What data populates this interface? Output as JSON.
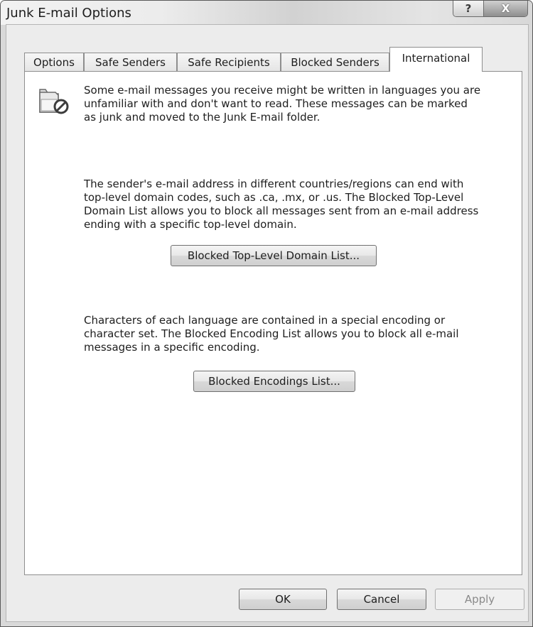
{
  "window": {
    "title": "Junk E-mail Options",
    "help_glyph": "?",
    "close_glyph": "X"
  },
  "tabs": [
    {
      "label": "Options",
      "active": false
    },
    {
      "label": "Safe Senders",
      "active": false
    },
    {
      "label": "Safe Recipients",
      "active": false
    },
    {
      "label": "Blocked Senders",
      "active": false
    },
    {
      "label": "International",
      "active": true
    }
  ],
  "panel": {
    "icon": "blocked-mailbox-icon",
    "intro": [
      "Some e-mail messages you receive might be written in languages you are",
      "unfamiliar with and don't want to read. These messages can be marked",
      "as junk and moved to the Junk E-mail folder."
    ],
    "tld_text": [
      "The sender's e-mail address in different countries/regions can end with",
      "top-level domain codes, such as .ca, .mx, or .us. The Blocked Top-Level",
      "Domain List allows you to block all messages sent from an e-mail address",
      "ending with a specific top-level domain."
    ],
    "tld_button": "Blocked Top-Level Domain List...",
    "encoding_text": [
      "Characters of each language are contained in a special encoding or",
      "character set. The Blocked Encoding List allows you to block all e-mail",
      "messages in a specific encoding."
    ],
    "encoding_button": "Blocked Encodings List..."
  },
  "footer": {
    "ok": "OK",
    "cancel": "Cancel",
    "apply": "Apply"
  }
}
